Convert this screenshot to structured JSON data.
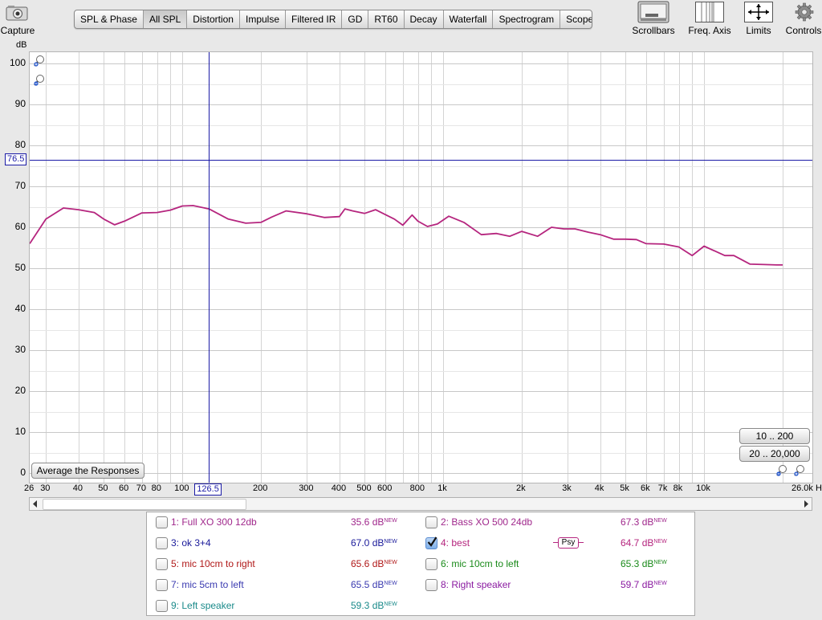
{
  "toolbar": {
    "capture": "Capture",
    "tabs": [
      "SPL & Phase",
      "All SPL",
      "Distortion",
      "Impulse",
      "Filtered IR",
      "GD",
      "RT60",
      "Decay",
      "Waterfall",
      "Spectrogram",
      "Scope"
    ],
    "active_tab": "All SPL",
    "tools": [
      "Scrollbars",
      "Freq. Axis",
      "Limits",
      "Controls"
    ]
  },
  "graph": {
    "y_unit": "dB",
    "y_ticks": [
      "100",
      "90",
      "80",
      "70",
      "60",
      "50",
      "40",
      "30",
      "20",
      "10",
      "0"
    ],
    "x_ticks": [
      "26",
      "30",
      "40",
      "50",
      "60",
      "70",
      "80",
      "100",
      "200",
      "300",
      "400",
      "500",
      "600",
      "800",
      "1k",
      "2k",
      "3k",
      "4k",
      "5k",
      "6k",
      "7k",
      "8k",
      "10k",
      "26.0k H"
    ],
    "cursor_x_label": "126.5",
    "cursor_y_label": "76.5",
    "trace_color": "#b5257e",
    "cursor_color": "#1a1aa6",
    "zoom_buttons": [
      "10 .. 200",
      "20 .. 20,000"
    ],
    "average_button": "Average the Responses"
  },
  "chart_data": {
    "type": "line",
    "title": "",
    "ylabel": "dB",
    "xlabel": "",
    "xscale": "log",
    "xlim": [
      26,
      26000
    ],
    "ylim": [
      0,
      100
    ],
    "series": [
      {
        "name": "4: best",
        "x": [
          26,
          30,
          35,
          40,
          46,
          50,
          55,
          60,
          70,
          80,
          90,
          100,
          110,
          126.5,
          150,
          175,
          200,
          220,
          250,
          300,
          350,
          400,
          420,
          450,
          500,
          550,
          600,
          650,
          700,
          760,
          800,
          870,
          950,
          1050,
          1200,
          1400,
          1600,
          1800,
          2000,
          2300,
          2600,
          2900,
          3200,
          3600,
          4000,
          4500,
          5000,
          5500,
          6000,
          7000,
          8000,
          9000,
          10000,
          11000,
          12000,
          13000,
          15000,
          17000,
          19000,
          20000
        ],
        "y": [
          56,
          62,
          64.7,
          64.3,
          63.6,
          62,
          60.6,
          61.5,
          63.5,
          63.6,
          64.2,
          65.2,
          65.3,
          64.5,
          62,
          61,
          61.2,
          62.5,
          64,
          63.3,
          62.4,
          62.6,
          64.5,
          64,
          63.4,
          64.3,
          63.1,
          62,
          60.5,
          63,
          61.5,
          60.2,
          60.8,
          62.7,
          61.2,
          58.2,
          58.5,
          57.8,
          59,
          57.8,
          60,
          59.6,
          59.6,
          58.8,
          58.2,
          57.1,
          57.1,
          57,
          56,
          55.9,
          55.2,
          53.1,
          55.4,
          54.2,
          53.1,
          53.1,
          51,
          50.9,
          50.8,
          50.8
        ]
      }
    ]
  },
  "legend": {
    "items": [
      {
        "label": "1: Full XO 300 12db",
        "value": "35.6 dB",
        "new": "NEW",
        "checked": false,
        "color": "#a0288c"
      },
      {
        "label": "2: Bass XO 500 24db",
        "value": "67.3 dB",
        "new": "NEW",
        "checked": false,
        "color": "#a0288c"
      },
      {
        "label": "3: ok 3+4",
        "value": "67.0 dB",
        "new": "NEW",
        "checked": false,
        "color": "#1a1a9a"
      },
      {
        "label": "4: best",
        "value": "64.7 dB",
        "new": "NEW",
        "checked": true,
        "color": "#b5257e"
      },
      {
        "label": "5: mic 10cm to right",
        "value": "65.6 dB",
        "new": "NEW",
        "checked": false,
        "color": "#b01818"
      },
      {
        "label": "6: mic 10cm to left",
        "value": "65.3 dB",
        "new": "NEW",
        "checked": false,
        "color": "#1a8a1a"
      },
      {
        "label": "7: mic 5cm to left",
        "value": "65.5 dB",
        "new": "NEW",
        "checked": false,
        "color": "#3a3ab0"
      },
      {
        "label": "8: Right speaker",
        "value": "59.7 dB",
        "new": "NEW",
        "checked": false,
        "color": "#8a1aa0"
      },
      {
        "label": "9: Left speaker",
        "value": "59.3 dB",
        "new": "NEW",
        "checked": false,
        "color": "#1a8a8a"
      }
    ],
    "psy_label": "Psy"
  }
}
